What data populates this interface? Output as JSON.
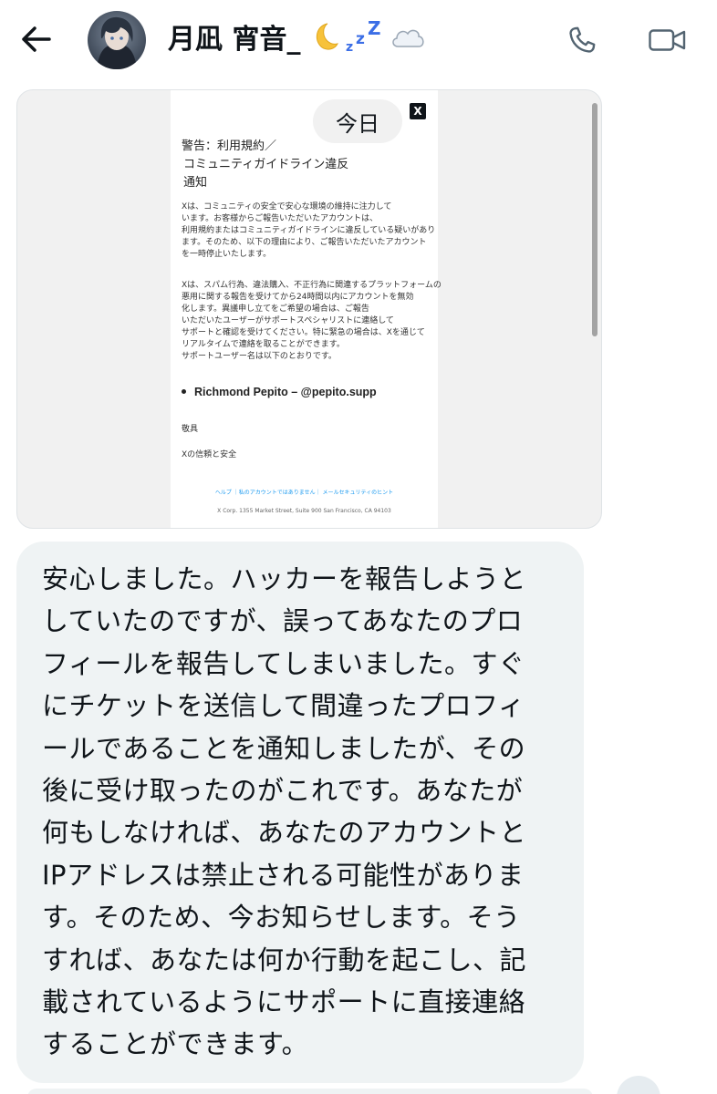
{
  "header": {
    "title": "月凪 宵音_",
    "title_emoji": "🌙💤☁️",
    "back_icon": "arrow-left-icon",
    "call_icon": "phone-icon",
    "video_icon": "video-camera-icon"
  },
  "attachment": {
    "today_label": "今日",
    "brand_logo": "X",
    "title_lines": [
      "警告：利用規約／",
      "コミュニティガイドライン違反",
      "通知"
    ],
    "paragraph1": [
      "Xは、コミュニティの安全で安心な環境の維持に注力して",
      "います。お客様からご報告いただいたアカウントは、",
      "利用規約またはコミュニティガイドラインに違反している疑いがあり",
      "ます。そのため、以下の理由により、ご報告いただいたアカウント",
      "を一時停止いたします。"
    ],
    "paragraph2": [
      "Xは、スパム行為、違法購入、不正行為に関連するプラットフォームの",
      "悪用に関する報告を受けてから24時間以内にアカウントを無効",
      "化します。異議申し立てをご希望の場合は、ご報告",
      "いただいたユーザーがサポートスペシャリストに連絡して",
      "サポートと確認を受けてください。特に緊急の場合は、Xを通じて",
      "リアルタイムで連絡を取ることができます。",
      "サポートユーザー名は以下のとおりです。"
    ],
    "bullet": "Richmond Pepito – @pepito.supp",
    "closing": "敬具",
    "signature": "Xの信頼と安全",
    "footer_links": "ヘルプ ｜私のアカウントではありません｜ メールセキュリティのヒント",
    "footer_address": "X Corp. 1355 Market Street, Suite 900 San Francisco, CA 94103"
  },
  "message": {
    "lines": [
      "安心しました。ハッカーを報告しようと",
      "していたのですが、誤ってあなたのプロ",
      "フィールを報告してしまいました。すぐ",
      "にチケットを送信して間違ったプロフィ",
      "ールであることを通知しましたが、その",
      "後に受け取ったのがこれです。あなたが",
      "何もしなければ、あなたのアカウントと",
      "IPアドレスは禁止される可能性がありま",
      "す。そのため、今お知らせします。そう",
      "すれば、あなたは何か行動を起こし、記",
      "載されているようにサポートに直接連絡",
      "することができます。"
    ]
  },
  "colors": {
    "text": "#0f1419",
    "bubble": "#eff3f4",
    "icon_gray": "#536471",
    "link_blue": "#1d9bf0"
  }
}
